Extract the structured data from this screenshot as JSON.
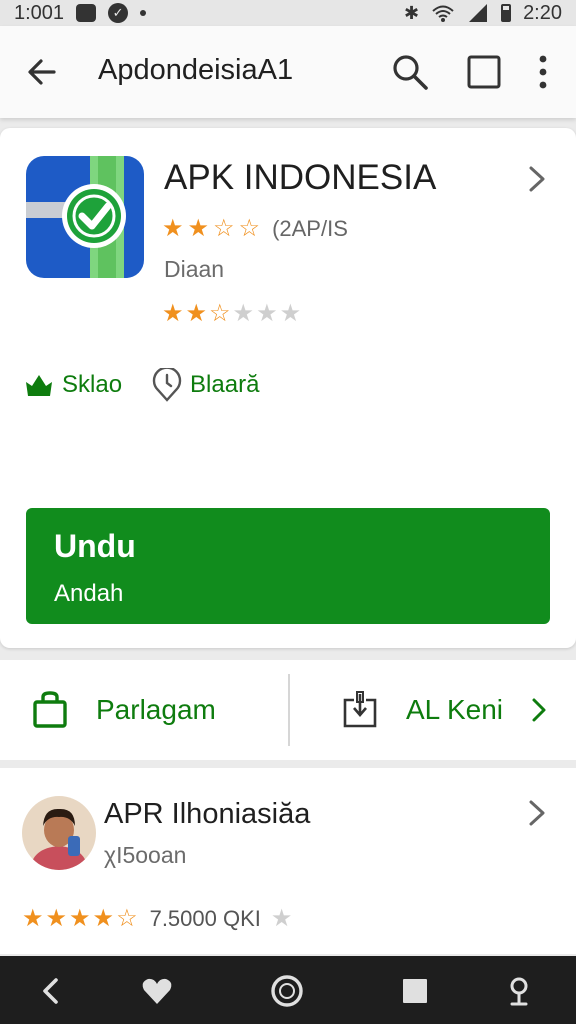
{
  "status_bar": {
    "time_left": "1:001",
    "time_right": "2:20"
  },
  "app_bar": {
    "title": "ApdondeisiaA1",
    "icons": [
      "back-arrow-icon",
      "search-icon",
      "square-icon",
      "more-vert-icon"
    ]
  },
  "app_card": {
    "name": "APK INDONESIA",
    "rating_text": "(2AP/IS",
    "developer": "Diaan",
    "rating_primary": 2.5,
    "rating_secondary": 2.5,
    "tags": [
      {
        "icon": "crown-icon",
        "label": "Sklao"
      },
      {
        "icon": "clock-pin-icon",
        "label": "Blaară"
      }
    ],
    "install_button": {
      "title": "Undu",
      "subtitle": "Andah"
    }
  },
  "actions": {
    "left": {
      "icon": "shopping-bag-icon",
      "label": "Parlagam"
    },
    "right": {
      "icon": "share-file-icon",
      "label": "AL Keni"
    }
  },
  "review_card": {
    "name": "APR Ilhoniasiăa",
    "subtitle": "χI5ooan",
    "rating": 4.5,
    "count_text": "7.5000 QKI"
  },
  "nav_bar": {
    "icons": [
      "nav-back-icon",
      "heart-icon",
      "home-circle-icon",
      "recents-square-icon",
      "assistant-icon"
    ]
  },
  "colors": {
    "accent_green": "#118c1d",
    "text_green": "#0e7c0e",
    "star_orange": "#f0901e"
  }
}
